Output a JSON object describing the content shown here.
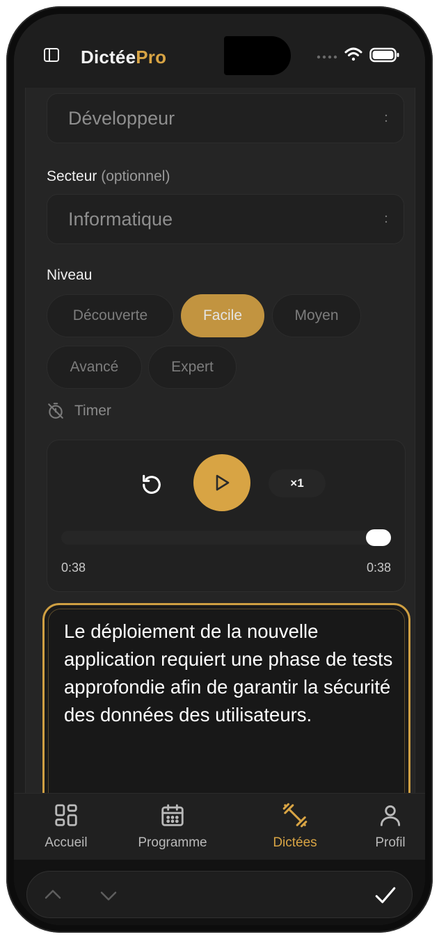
{
  "app": {
    "brand_main": "Dictée",
    "brand_accent": "Pro",
    "accent_color": "#d8a444"
  },
  "status": {
    "icons": [
      "signal-dots-icon",
      "wifi-icon",
      "battery-icon"
    ]
  },
  "form": {
    "role_value": "Développeur",
    "sector_label": "Secteur",
    "sector_optional": "(optionnel)",
    "sector_value": "Informatique",
    "level_label": "Niveau",
    "levels": [
      "Découverte",
      "Facile",
      "Moyen",
      "Avancé",
      "Expert"
    ],
    "selected_level": "Facile",
    "timer_label": "Timer"
  },
  "player": {
    "speed": "×1",
    "current_time": "0:38",
    "total_time": "0:38",
    "progress": 1.0
  },
  "dictation": {
    "text": "Le déploiement de la nouvelle application requiert une phase de tests approfondie afin de garantir la sécurité des données des utilisateurs."
  },
  "tabs": [
    {
      "label": "Accueil",
      "icon": "grid-icon"
    },
    {
      "label": "Programme",
      "icon": "calendar-icon"
    },
    {
      "label": "Dictées",
      "icon": "dumbbell-icon",
      "active": true
    },
    {
      "label": "Profil",
      "icon": "user-icon"
    }
  ],
  "keyboard_bar": {
    "icons": [
      "chevron-up-icon",
      "chevron-down-icon",
      "checkmark-icon"
    ]
  }
}
